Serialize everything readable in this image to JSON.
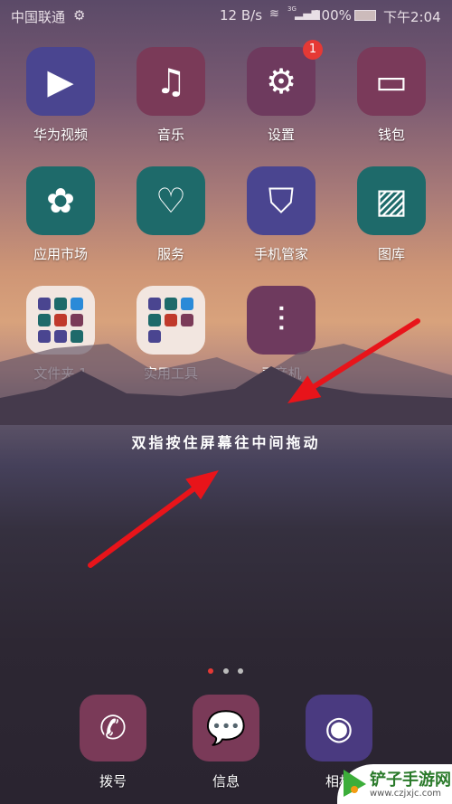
{
  "status": {
    "carrier": "中国联通",
    "speed": "12 B/s",
    "network": "3G",
    "battery": "100%",
    "time": "下午2:04"
  },
  "apps": [
    {
      "label": "华为视频",
      "icon": "play-icon",
      "color": "#4a4590"
    },
    {
      "label": "音乐",
      "icon": "music-note-icon",
      "color": "#7a3a58"
    },
    {
      "label": "设置",
      "icon": "gear-icon",
      "color": "#6e3a5e",
      "badge": "1"
    },
    {
      "label": "钱包",
      "icon": "wallet-icon",
      "color": "#7a3a5a"
    },
    {
      "label": "应用市场",
      "icon": "huawei-logo-icon",
      "color": "#1e6a6a"
    },
    {
      "label": "服务",
      "icon": "heart-hand-icon",
      "color": "#1e6a6a"
    },
    {
      "label": "手机管家",
      "icon": "shield-icon",
      "color": "#4a4590"
    },
    {
      "label": "图库",
      "icon": "gallery-icon",
      "color": "#1e6a6a"
    },
    {
      "label": "文件夹 1",
      "icon": "folder-icon",
      "color": "#f2e6e0"
    },
    {
      "label": "实用工具",
      "icon": "folder-icon",
      "color": "#f2e6e0"
    },
    {
      "label": "录音机",
      "icon": "waveform-icon",
      "color": "#6e3a5e"
    }
  ],
  "hint": "双指按住屏幕往中间拖动",
  "dock": [
    {
      "label": "拨号",
      "icon": "phone-icon",
      "color": "#7a3a58"
    },
    {
      "label": "信息",
      "icon": "message-icon",
      "color": "#7a3a58"
    },
    {
      "label": "相机",
      "icon": "camera-icon",
      "color": "#4a3a80"
    }
  ],
  "pages": {
    "count": 3,
    "current": 1,
    "active_color": "#e53935"
  },
  "arrow_color": "#e8141a",
  "watermark": {
    "name": "铲子手游网",
    "url": "www.czjxjc.com"
  }
}
